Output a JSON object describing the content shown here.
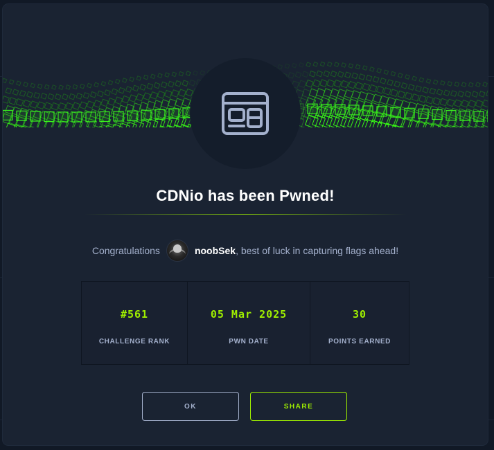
{
  "modal": {
    "title": "CDNio has been Pwned!",
    "congrats_prefix": "Congratulations",
    "username": "noobSek",
    "congrats_suffix": ", best of luck in capturing flags ahead!"
  },
  "stats": [
    {
      "value": "#561",
      "label": "CHALLENGE RANK"
    },
    {
      "value": "05 Mar 2025",
      "label": "PWN DATE"
    },
    {
      "value": "30",
      "label": "POINTS EARNED"
    }
  ],
  "buttons": {
    "ok_label": "OK",
    "share_label": "SHARE"
  },
  "icons": {
    "emblem": "web-browser-icon",
    "avatar": "user-avatar"
  },
  "colors": {
    "accent": "#9fef00",
    "panel": "#1a2332",
    "text_muted": "#a4b1cd"
  }
}
